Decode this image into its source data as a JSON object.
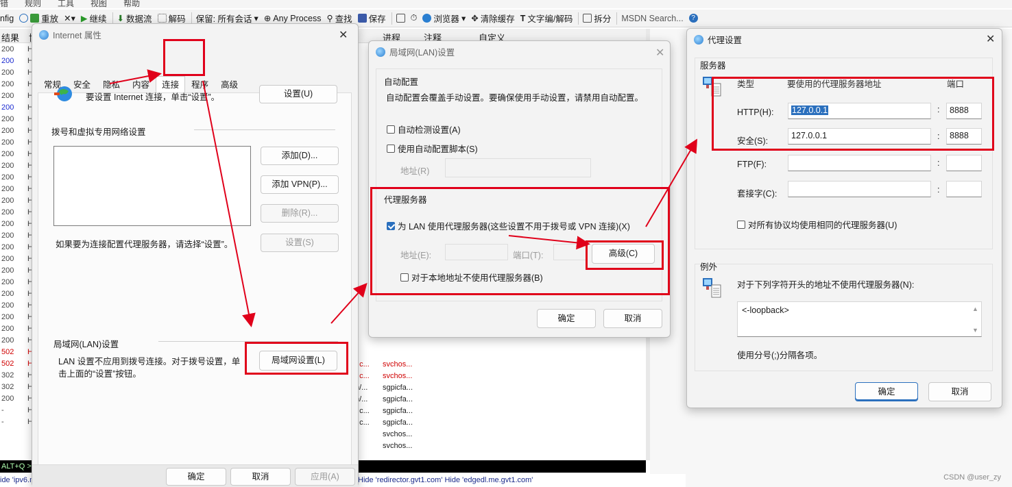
{
  "menubar": [
    "错",
    "规则",
    "工具",
    "视图",
    "帮助"
  ],
  "toolbar": {
    "items": [
      "nfig",
      "重放",
      "继续",
      "数据流",
      "解码",
      "保留: 所有会话",
      "Any Process",
      "查找",
      "保存",
      "浏览器",
      "清除缓存",
      "文字编/解码",
      "拆分",
      "MSDN Search..."
    ]
  },
  "session_list": {
    "headers": [
      "结果",
      "协",
      "进程",
      "注释",
      "自定义"
    ],
    "results": [
      "200",
      "200",
      "200",
      "200",
      "200",
      "200",
      "200",
      "200",
      "200",
      "200",
      "200",
      "200",
      "200",
      "200",
      "200",
      "200",
      "200",
      "200",
      "200",
      "200",
      "200",
      "200",
      "200",
      "200",
      "200",
      "200",
      "502",
      "502",
      "302",
      "302",
      "200",
      "-",
      "-"
    ],
    "bottom_rows": [
      {
        "a": "; c...",
        "b": "svchos..."
      },
      {
        "a": "; c...",
        "b": "svchos..."
      },
      {
        "a": "n/...",
        "b": "sgpicfa..."
      },
      {
        "a": "n/...",
        "b": "sgpicfa..."
      },
      {
        "a": "; c...",
        "b": "sgpicfa..."
      },
      {
        "a": "; c...",
        "b": "sgpicfa..."
      },
      {
        "a": "",
        "b": "svchos..."
      },
      {
        "a": "",
        "b": "svchos..."
      }
    ],
    "status": "ALT+Q >",
    "quickexec": "ide 'ipv6.m",
    "filter_hints": "Hide 'redirector.gvt1.com'   Hide 'edgedl.me.gvt1.com'"
  },
  "internet_props": {
    "title": "Internet 属性",
    "tabs": [
      "常规",
      "安全",
      "隐私",
      "内容",
      "连接",
      "程序",
      "高级"
    ],
    "setup_text": "要设置 Internet 连接，单击“设置”。",
    "setup_button": "设置(U)",
    "vpn_group": "拨号和虚拟专用网络设置",
    "add_button": "添加(D)...",
    "add_vpn_button": "添加 VPN(P)...",
    "remove_button": "删除(R)...",
    "settings_button": "设置(S)",
    "proxy_hint": "如果要为连接配置代理服务器，请选择“设置”。",
    "lan_group": "局域网(LAN)设置",
    "lan_text": "LAN 设置不应用到拨号连接。对于拨号设置，单击上面的“设置”按钮。",
    "lan_button": "局域网设置(L)",
    "ok": "确定",
    "cancel": "取消",
    "apply": "应用(A)"
  },
  "lan_settings": {
    "title": "局域网(LAN)设置",
    "auto_group": "自动配置",
    "auto_text": "自动配置会覆盖手动设置。要确保使用手动设置，请禁用自动配置。",
    "auto_detect": "自动检测设置(A)",
    "auto_script": "使用自动配置脚本(S)",
    "address_label": "地址(R)",
    "proxy_group": "代理服务器",
    "use_proxy": "为 LAN 使用代理服务器(这些设置不用于拨号或 VPN 连接)(X)",
    "proxy_address_label": "地址(E):",
    "proxy_port_label": "端口(T):",
    "advanced_button": "高级(C)",
    "bypass_local": "对于本地地址不使用代理服务器(B)",
    "ok": "确定",
    "cancel": "取消"
  },
  "proxy_settings": {
    "title": "代理设置",
    "servers_group": "服务器",
    "col_type": "类型",
    "col_address": "要使用的代理服务器地址",
    "col_port": "端口",
    "http_label": "HTTP(H):",
    "http_address": "127.0.0.1",
    "http_port": "8888",
    "secure_label": "安全(S):",
    "secure_address": "127.0.0.1",
    "secure_port": "8888",
    "ftp_label": "FTP(F):",
    "socks_label": "套接字(C):",
    "same_for_all": "对所有协议均使用相同的代理服务器(U)",
    "exceptions_group": "例外",
    "exceptions_text": "对于下列字符开头的地址不使用代理服务器(N):",
    "exceptions_value": "<-loopback>",
    "separator_hint": "使用分号(;)分隔各项。",
    "ok": "确定",
    "cancel": "取消"
  },
  "watermark": "CSDN @user_zy",
  "colors": {
    "annotation_red": "#e0001a",
    "accent": "#2a6fbd"
  }
}
